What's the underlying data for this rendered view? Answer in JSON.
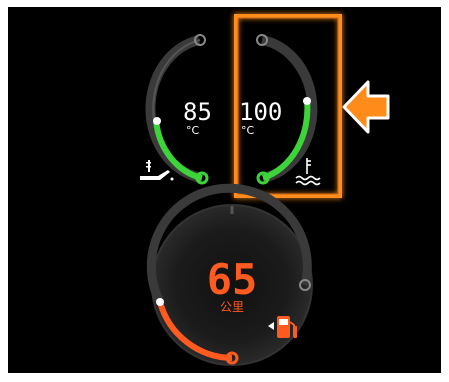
{
  "oil_temp_gauge": {
    "value": "85",
    "unit": "°C",
    "icon": "oil-temperature-icon",
    "accent": "#3dd43a"
  },
  "coolant_temp_gauge": {
    "value": "100",
    "unit": "°C",
    "icon": "coolant-temperature-icon",
    "accent": "#3dd43a",
    "highlighted": true
  },
  "fuel_range_gauge": {
    "value": "65",
    "unit": "公里",
    "icon": "fuel-pump-icon",
    "accent": "#ff5a1f"
  },
  "callout": {
    "icon": "arrow-left-icon",
    "color": "#ff8c1a"
  }
}
